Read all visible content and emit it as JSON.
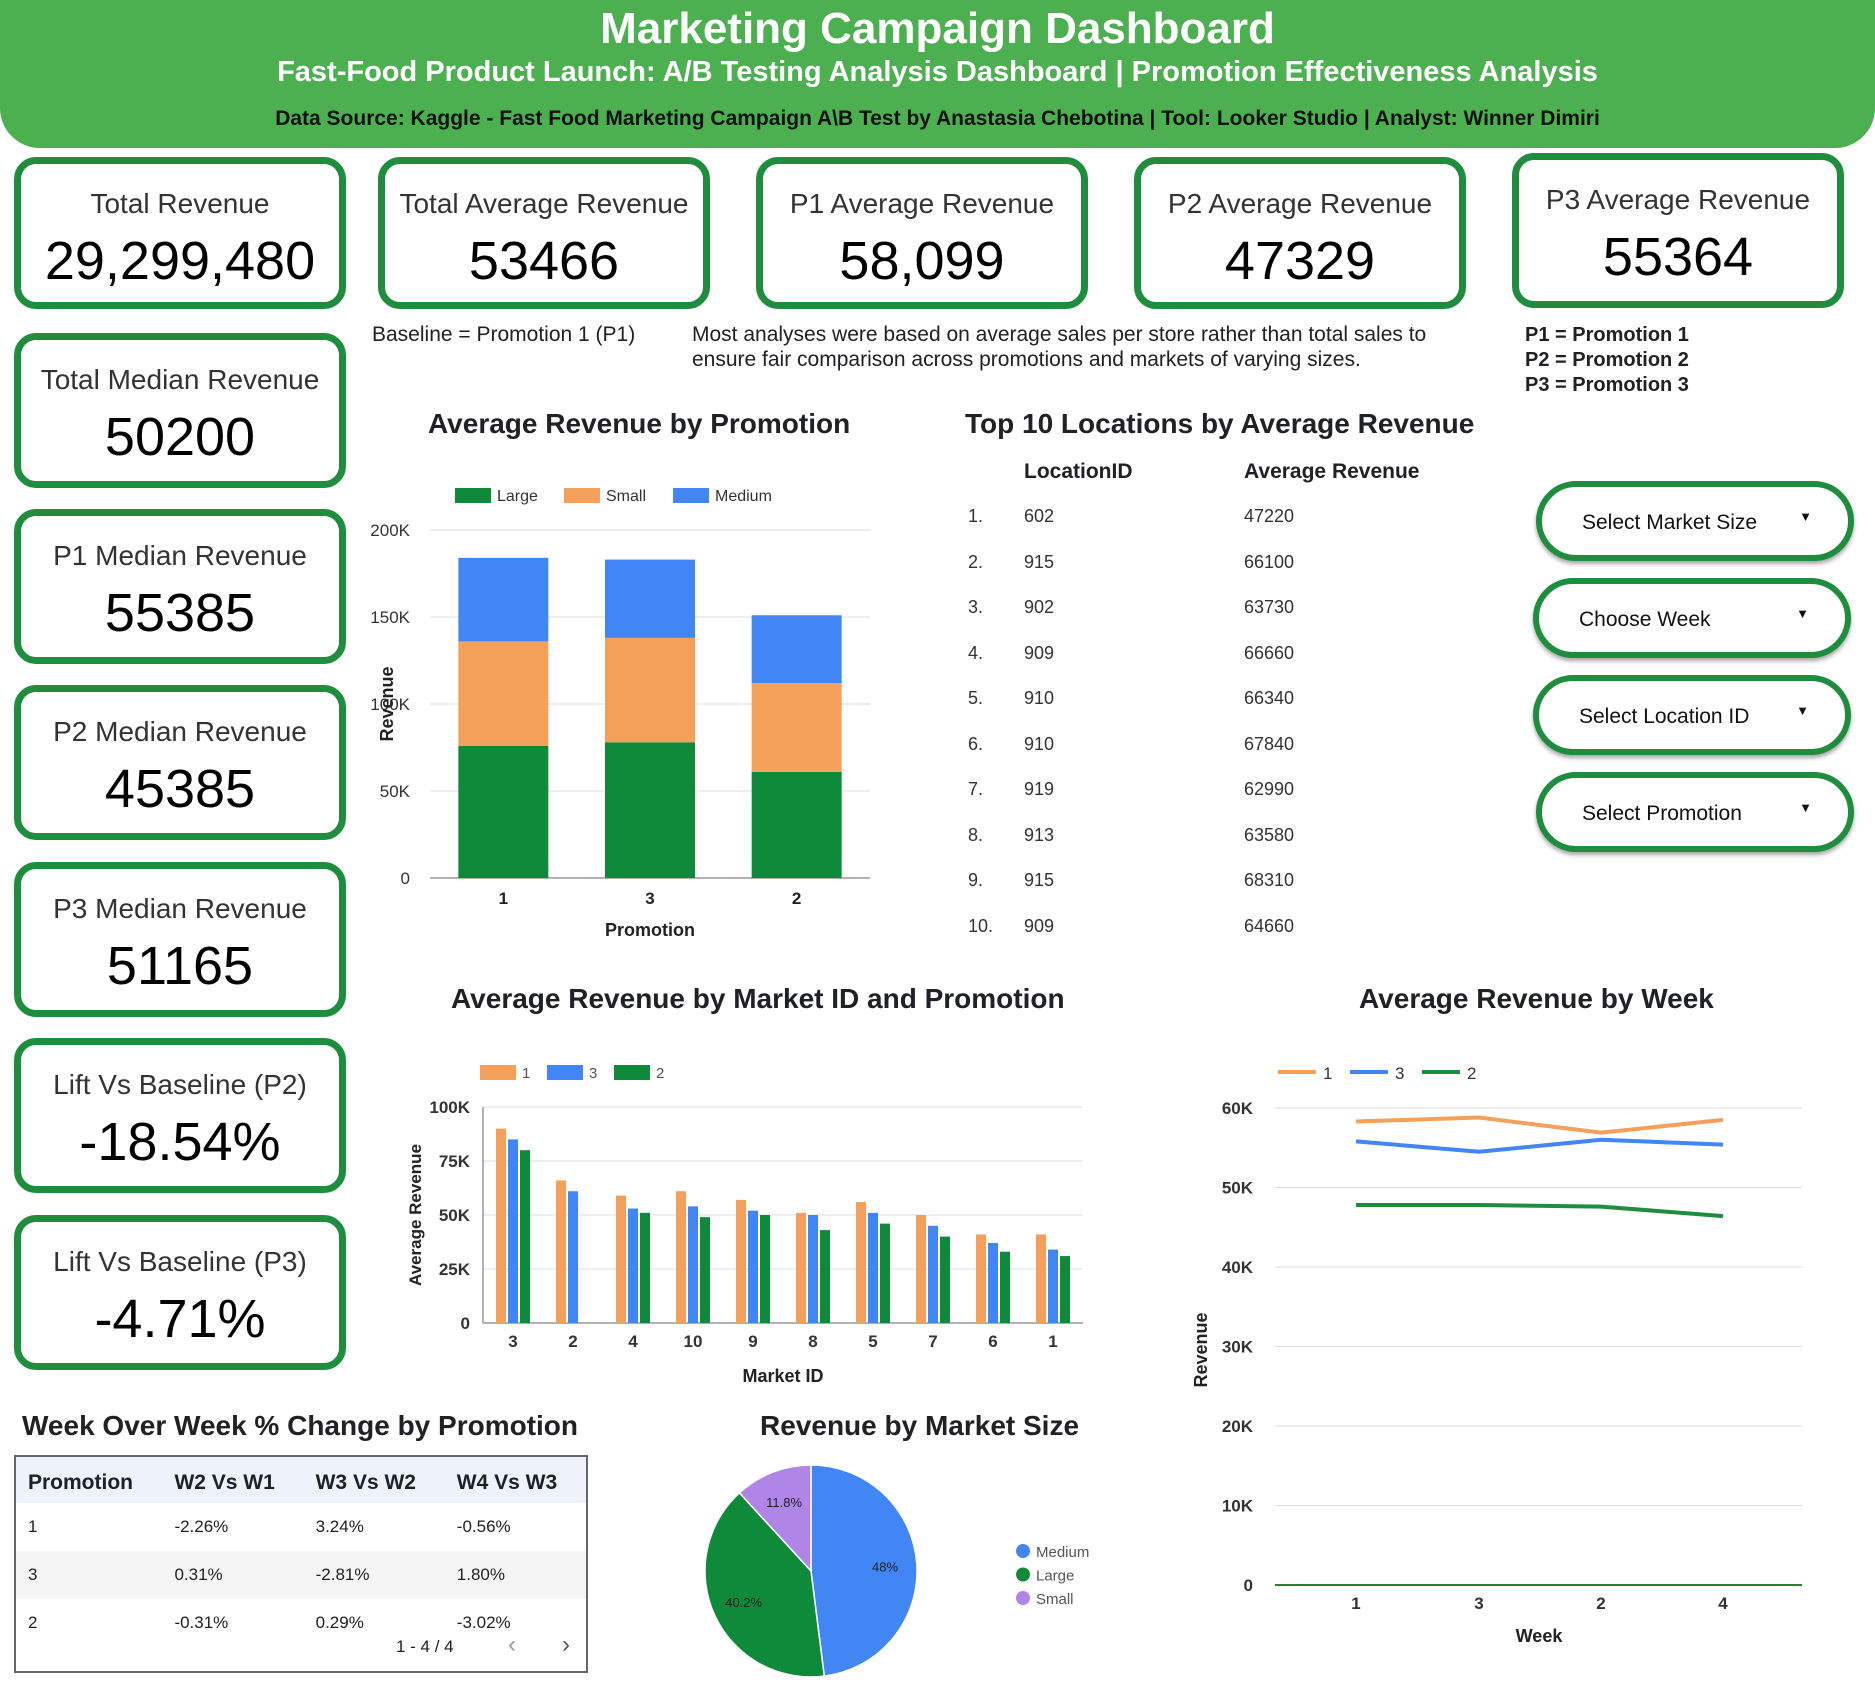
{
  "header": {
    "title": "Marketing Campaign Dashboard",
    "subtitle": "Fast-Food Product Launch: A/B Testing Analysis Dashboard | Promotion Effectiveness Analysis",
    "source": "Data Source: Kaggle - Fast Food Marketing Campaign A\\B Test by Anastasia Chebotina | Tool: Looker Studio | Analyst: Winner Dimiri"
  },
  "kpis": {
    "total_revenue": {
      "label": "Total Revenue",
      "value": "29,299,480"
    },
    "total_avg": {
      "label": "Total Average Revenue",
      "value": "53466"
    },
    "p1_avg": {
      "label": "P1 Average Revenue",
      "value": "58,099"
    },
    "p2_avg": {
      "label": "P2 Average Revenue",
      "value": "47329"
    },
    "p3_avg": {
      "label": "P3 Average Revenue",
      "value": "55364"
    },
    "total_median": {
      "label": "Total Median Revenue",
      "value": "50200"
    },
    "p1_median": {
      "label": "P1 Median Revenue",
      "value": "55385"
    },
    "p2_median": {
      "label": "P2 Median Revenue",
      "value": "45385"
    },
    "p3_median": {
      "label": "P3 Median Revenue",
      "value": "51165"
    },
    "lift_p2": {
      "label": "Lift Vs Baseline (P2)",
      "value": "-18.54%"
    },
    "lift_p3": {
      "label": "Lift Vs Baseline (P3)",
      "value": "-4.71%"
    }
  },
  "notes": {
    "baseline": "Baseline = Promotion 1 (P1)",
    "method_line1": "Most analyses were based on average sales per store rather than total sales to",
    "method_line2": "ensure fair comparison across promotions and markets of varying sizes.",
    "legend": [
      "P1 = Promotion 1",
      "P2 = Promotion 2",
      "P3 = Promotion 3"
    ]
  },
  "filters": {
    "market_size": "Select Market Size",
    "week": "Choose Week",
    "location": "Select Location ID",
    "promotion": "Select Promotion"
  },
  "top10": {
    "title": "Top 10 Locations by Average Revenue",
    "col_location": "LocationID",
    "col_revenue": "Average Revenue",
    "rows": [
      {
        "rank": "1.",
        "location": "602",
        "revenue": "47220"
      },
      {
        "rank": "2.",
        "location": "915",
        "revenue": "66100"
      },
      {
        "rank": "3.",
        "location": "902",
        "revenue": "63730"
      },
      {
        "rank": "4.",
        "location": "909",
        "revenue": "66660"
      },
      {
        "rank": "5.",
        "location": "910",
        "revenue": "66340"
      },
      {
        "rank": "6.",
        "location": "910",
        "revenue": "67840"
      },
      {
        "rank": "7.",
        "location": "919",
        "revenue": "62990"
      },
      {
        "rank": "8.",
        "location": "913",
        "revenue": "63580"
      },
      {
        "rank": "9.",
        "location": "915",
        "revenue": "68310"
      },
      {
        "rank": "10.",
        "location": "909",
        "revenue": "64660"
      }
    ]
  },
  "wow": {
    "title": "Week Over Week % Change by Promotion",
    "headers": [
      "Promotion",
      "W2 Vs W1",
      "W3 Vs W2",
      "W4 Vs W3"
    ],
    "rows": [
      [
        "1",
        "-2.26%",
        "3.24%",
        "-0.56%"
      ],
      [
        "3",
        "0.31%",
        "-2.81%",
        "1.80%"
      ],
      [
        "2",
        "-0.31%",
        "0.29%",
        "-3.02%"
      ]
    ],
    "pagination": "1 - 4 / 4"
  },
  "chart_data": [
    {
      "id": "stacked",
      "type": "bar",
      "stacked": true,
      "title": "Average Revenue by Promotion",
      "xlabel": "Promotion",
      "ylabel": "Revenue",
      "categories": [
        "1",
        "3",
        "2"
      ],
      "ylim": [
        0,
        200000
      ],
      "yticks": [
        0,
        50000,
        100000,
        150000,
        200000
      ],
      "ytick_labels": [
        "0",
        "50K",
        "100K",
        "150K",
        "200K"
      ],
      "legend_position": "top",
      "series": [
        {
          "name": "Large",
          "color": "#0f8a3a",
          "values": [
            76000,
            78000,
            61000
          ]
        },
        {
          "name": "Small",
          "color": "#f4a05a",
          "values": [
            60000,
            60000,
            51000
          ]
        },
        {
          "name": "Medium",
          "color": "#4285f4",
          "values": [
            48000,
            45000,
            39000
          ]
        }
      ]
    },
    {
      "id": "market",
      "type": "bar",
      "title": "Average Revenue by Market ID and Promotion",
      "xlabel": "Market ID",
      "ylabel": "Average Revenue",
      "categories": [
        "3",
        "2",
        "4",
        "10",
        "9",
        "8",
        "5",
        "7",
        "6",
        "1"
      ],
      "ylim": [
        0,
        100000
      ],
      "yticks": [
        0,
        25000,
        50000,
        75000,
        100000
      ],
      "ytick_labels": [
        "0",
        "25K",
        "50K",
        "75K",
        "100K"
      ],
      "legend_position": "top-left",
      "series": [
        {
          "name": "1",
          "color": "#f4a05a",
          "values": [
            90000,
            66000,
            59000,
            61000,
            57000,
            51000,
            56000,
            50000,
            41000,
            41000
          ]
        },
        {
          "name": "3",
          "color": "#4285f4",
          "values": [
            85000,
            61000,
            53000,
            54000,
            52000,
            50000,
            51000,
            45000,
            37000,
            34000
          ]
        },
        {
          "name": "2",
          "color": "#0f8a3a",
          "values": [
            80000,
            null,
            51000,
            49000,
            50000,
            43000,
            46000,
            40000,
            33000,
            31000
          ]
        }
      ]
    },
    {
      "id": "week",
      "type": "line",
      "title": "Average Revenue by Week",
      "xlabel": "Week",
      "ylabel": "Revenue",
      "categories": [
        "1",
        "3",
        "2",
        "4"
      ],
      "ylim": [
        0,
        60000
      ],
      "yticks": [
        0,
        10000,
        20000,
        30000,
        40000,
        50000,
        60000
      ],
      "ytick_labels": [
        "0",
        "10K",
        "20K",
        "30K",
        "40K",
        "50K",
        "60K"
      ],
      "legend_position": "top-left",
      "series": [
        {
          "name": "1",
          "color": "#f4a05a",
          "values": [
            58300,
            58800,
            56900,
            58500
          ]
        },
        {
          "name": "3",
          "color": "#4285f4",
          "values": [
            55800,
            54500,
            56000,
            55400
          ]
        },
        {
          "name": "2",
          "color": "#1e8e3e",
          "values": [
            47800,
            47800,
            47600,
            46400
          ]
        }
      ]
    },
    {
      "id": "pie",
      "type": "pie",
      "title": "Revenue by Market Size",
      "legend_position": "right",
      "slices": [
        {
          "name": "Medium",
          "value": 48,
          "label": "48%",
          "color": "#4285f4"
        },
        {
          "name": "Large",
          "value": 40.2,
          "label": "40.2%",
          "color": "#0f8a3a"
        },
        {
          "name": "Small",
          "value": 11.8,
          "label": "11.8%",
          "color": "#b085e8"
        }
      ]
    }
  ]
}
